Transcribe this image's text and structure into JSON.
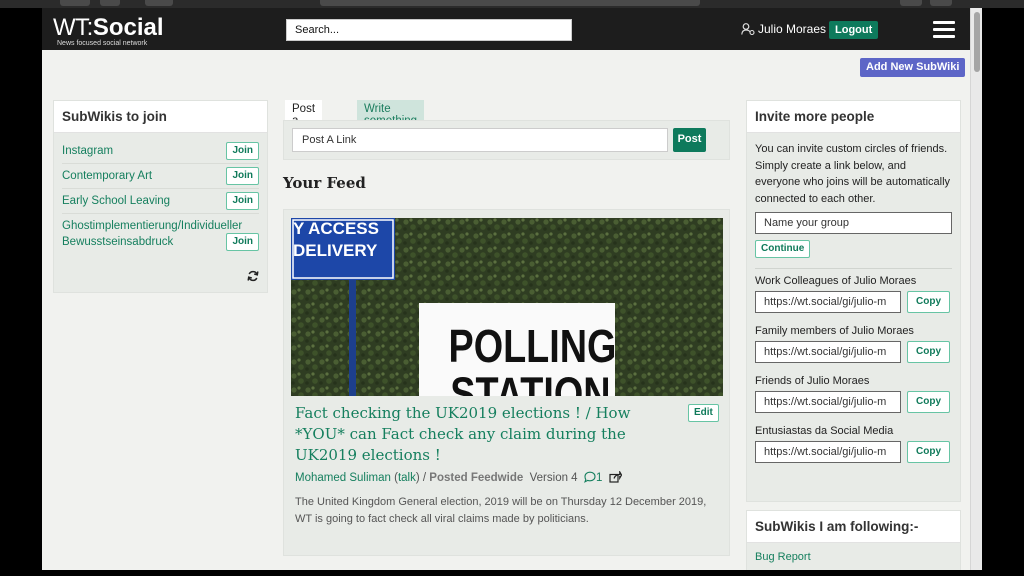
{
  "navbar": {
    "logo_wt": "WT:",
    "logo_social": "Social",
    "logo_tagline": "News focused social network",
    "search_placeholder": "Search...",
    "username": "Julio Moraes",
    "logout_label": "Logout"
  },
  "add_subwiki_label": "Add New SubWiki",
  "subwikis_to_join": {
    "title": "SubWikis to join",
    "join_label": "Join",
    "items": [
      {
        "label": "Instagram"
      },
      {
        "label": "Contemporary Art"
      },
      {
        "label": "Early School Leaving"
      },
      {
        "label": "Ghostimplementierung/Individueller Bewusstseinsabdruck"
      }
    ]
  },
  "post_box": {
    "tab_link": "Post a link",
    "tab_write": "Write something",
    "input_placeholder": "Post A Link",
    "post_label": "Post"
  },
  "feed": {
    "title": "Your Feed",
    "post": {
      "image_text_top1": "Y ACCESS",
      "image_text_top2": "DELIVERY",
      "image_text_sign1": "POLLING",
      "image_text_sign2": "STATION",
      "edit_label": "Edit",
      "title": "Fact checking the UK2019 elections ! / How *YOU* can Fact check any claim during the UK2019 elections !",
      "author": "Mohamed Suliman",
      "talk": "talk",
      "posted": "Posted Feedwide",
      "version": "Version 4",
      "comment_count": "1",
      "excerpt": "The United Kingdom General election, 2019  will be on Thursday 12 December 2019, WT is going to fact check all viral claims made by politicians."
    }
  },
  "invite": {
    "title": "Invite more people",
    "text": "You can invite custom circles of friends. Simply create a link below, and everyone who joins will be automatically connected to each other.",
    "group_placeholder": "Name your group",
    "continue_label": "Continue",
    "copy_label": "Copy",
    "links": [
      {
        "label": "Work Colleagues of Julio Moraes",
        "url": "https://wt.social/gi/julio-m"
      },
      {
        "label": "Family members of Julio Moraes",
        "url": "https://wt.social/gi/julio-m"
      },
      {
        "label": "Friends of Julio Moraes",
        "url": "https://wt.social/gi/julio-m"
      },
      {
        "label": "Entusiastas da Social Media",
        "url": "https://wt.social/gi/julio-m"
      }
    ]
  },
  "following": {
    "title": "SubWikis I am following:-",
    "items": [
      {
        "label": "Bug Report"
      }
    ]
  }
}
